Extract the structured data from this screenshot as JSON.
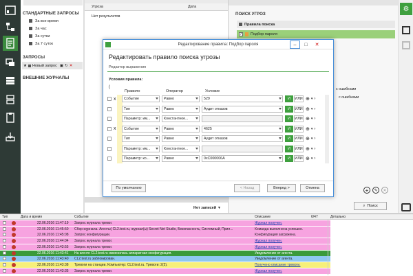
{
  "sidebar": {
    "section_standard": "СТАНДАРТНЫЕ ЗАПРОСЫ",
    "standard_items": [
      "За все время",
      "За час",
      "За сутки",
      "За 7 суток"
    ],
    "section_queries": "ЗАПРОСЫ",
    "new_query": "Новый запрос",
    "section_external": "ВНЕШНИЕ ЖУРНАЛЫ"
  },
  "grid": {
    "col_request": "Угроза",
    "col_date": "Дата",
    "empty_text": "Нет результатов",
    "records_label": "Нет записей"
  },
  "threat_panel": {
    "title": "ПОИСК УГРОЗ",
    "rules_header": "Правила поиска",
    "rule_item": "Подбор пароля",
    "partial_1": "с ошибками",
    "partial_2": "с ошибками",
    "search_button": "Поиск"
  },
  "dialog": {
    "window_title": "Редактирование правила: Подбор пароля",
    "heading": "Редактировать правило поиска угрозы",
    "subheading": "Редактор выражения",
    "conditions_label": "Условия правила:",
    "col_rule": "Правило",
    "col_operator": "Оператор",
    "col_condition": "Условие",
    "rows": [
      {
        "rule": "Событие",
        "op": "Равно",
        "cond": "529",
        "marker": "x",
        "dropdown": true
      },
      {
        "rule": "Тип",
        "op": "Равно",
        "cond": "Аудит отказов",
        "marker": "",
        "dropdown": true
      },
      {
        "rule": "Параметр: им...",
        "op": "Константное...",
        "cond": "",
        "marker": "",
        "dropdown": false
      },
      {
        "rule": "Событие",
        "op": "Равно",
        "cond": "4625",
        "marker": "x",
        "dropdown": true
      },
      {
        "rule": "Тип",
        "op": "Равно",
        "cond": "Аудит отказов",
        "marker": "",
        "dropdown": true
      },
      {
        "rule": "Параметр: им...",
        "op": "Константное...",
        "cond": "",
        "marker": "",
        "dropdown": false
      },
      {
        "rule": "Параметр: ко...",
        "op": "Равно",
        "cond": "0xC000006A",
        "marker": "",
        "dropdown": true
      }
    ],
    "and_label": "И",
    "or_label": "ИЛИ",
    "default_button": "По умолчанию",
    "back_button": "< Назад",
    "next_button": "Вперед >",
    "cancel_button": "Отмена"
  },
  "log": {
    "headers": [
      "Тип",
      "Дата и время",
      "Событие",
      "Описание",
      "6/47",
      "Детально"
    ],
    "rows": [
      {
        "date": "22.06.2016 11:47:19",
        "event": "Запрос журнала тревог.",
        "desc": "Журнал получен.",
        "bg": "#f7a3e0",
        "link": true
      },
      {
        "date": "22.06.2016 11:45:50",
        "event": "Сбор журнала. Агенты( CL2.test.ru, журнал(ы) Secret Net Studio, Безопасность, Системный, Прил...",
        "desc": "Команда выполнена успешно.",
        "bg": "#f7a3e0",
        "link": false
      },
      {
        "date": "22.06.2016 11:45:08",
        "event": "Запрос конфигурации.",
        "desc": "Конфигурация загружена.",
        "bg": "#f7a3e0",
        "link": false
      },
      {
        "date": "22.06.2016 11:44:04",
        "event": "Запрос журнала тревог.",
        "desc": "Журнал получен.",
        "bg": "#f7a3e0",
        "link": true
      },
      {
        "date": "22.06.2016 11:43:55",
        "event": "Запрос журнала тревог.",
        "desc": "Журнал получен.",
        "bg": "#f7a3e0",
        "link": true
      },
      {
        "date": "22.06.2016 11:43:41",
        "event": "На агенте CL2.test.ru изменилась аппаратная конфигурация.",
        "desc": "Уведомление от агента.",
        "bg": "#3a9a3a",
        "link": false
      },
      {
        "date": "22.06.2016 11:43:40",
        "event": "CL2.test.ru заблокирован.",
        "desc": "Уведомление от агента.",
        "bg": "#8ec8f0",
        "link": false
      },
      {
        "date": "22.06.2016 11:43:38",
        "event": "Тревоги на станции. Компьютер: CL2.test.ru. Тревоги: 2(2).",
        "desc": "Получено описание тревоги.",
        "bg": "#f7f07a",
        "link": true
      },
      {
        "date": "22.06.2016 11:43:35",
        "event": "Запрос журнала тревог.",
        "desc": "Журнал получен.",
        "bg": "#f7a3e0",
        "link": true
      }
    ]
  },
  "colors": {
    "accent": "#3fa03f",
    "sidebar_bg": "#2e3a36",
    "alarm_pink": "#f7a3e0"
  }
}
